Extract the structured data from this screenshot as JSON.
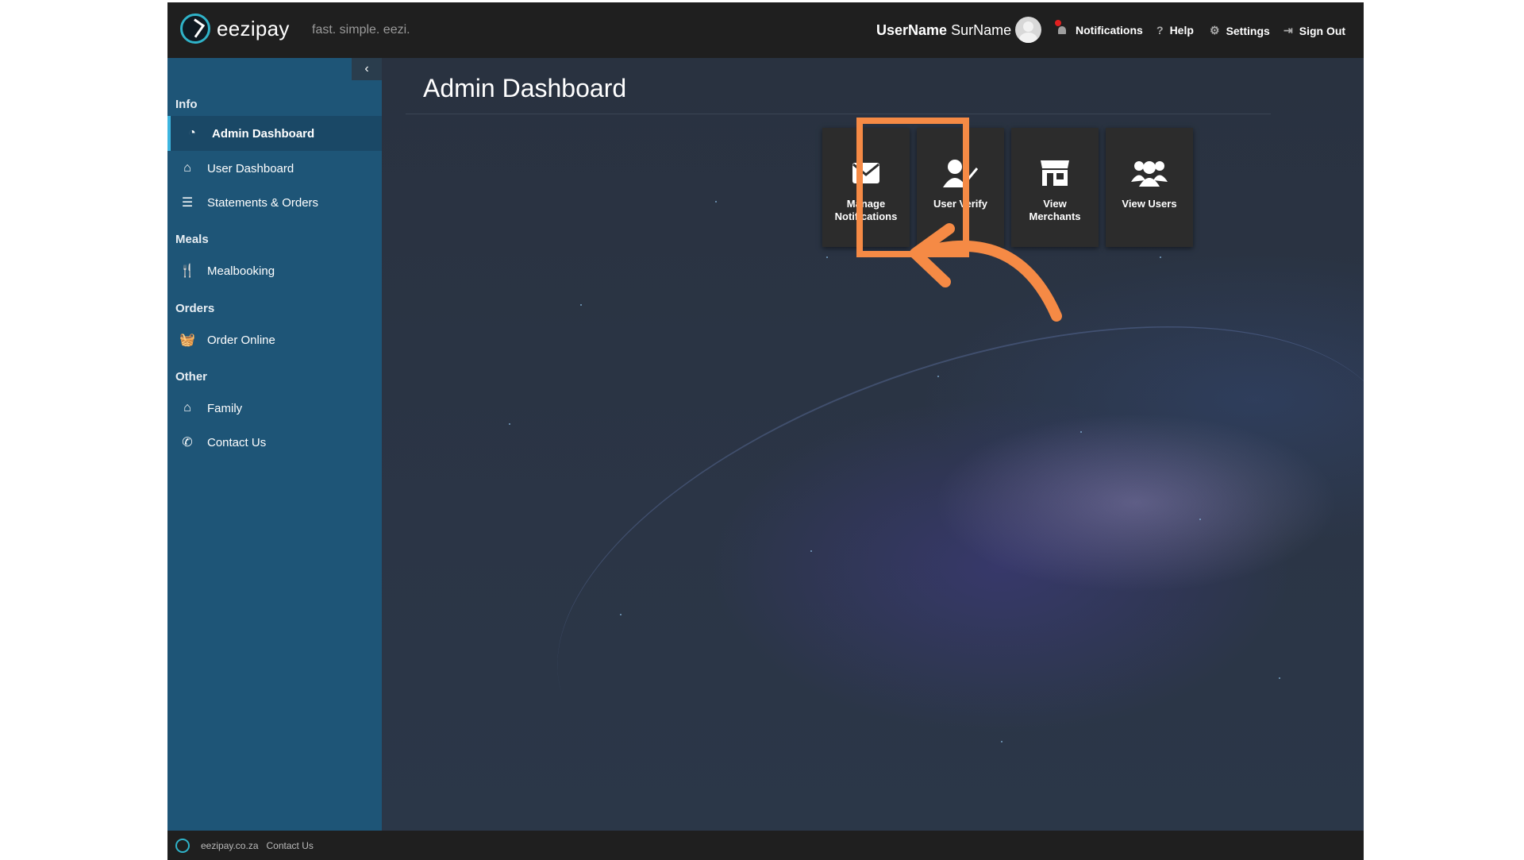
{
  "header": {
    "brand": "eezipay",
    "tagline": "fast. simple. eezi.",
    "user_first": "UserName",
    "user_last": "SurName",
    "nav": {
      "notifications": "Notifications",
      "help": "Help",
      "settings": "Settings",
      "sign_out": "Sign Out"
    }
  },
  "sidebar": {
    "collapse_glyph": "‹",
    "sections": {
      "info": "Info",
      "meals": "Meals",
      "orders": "Orders",
      "other": "Other"
    },
    "items": {
      "admin_dashboard": "Admin Dashboard",
      "user_dashboard": "User Dashboard",
      "statements_orders": "Statements & Orders",
      "mealbooking": "Mealbooking",
      "order_online": "Order Online",
      "family": "Family",
      "contact_us": "Contact Us"
    }
  },
  "main": {
    "title": "Admin Dashboard",
    "tiles": {
      "manage_notifications_1": "Manage",
      "manage_notifications_2": "Notifications",
      "user_verify": "User Verify",
      "view_merchants_1": "View",
      "view_merchants_2": "Merchants",
      "view_users": "View Users"
    },
    "highlight_color": "#f58a45"
  },
  "footer": {
    "site": "eezipay.co.za",
    "contact": "Contact Us"
  },
  "colors": {
    "sidebar": "#1e5577",
    "topbar": "#1f1f1f",
    "accent": "#3db5df",
    "tile": "#2c2c2c"
  }
}
